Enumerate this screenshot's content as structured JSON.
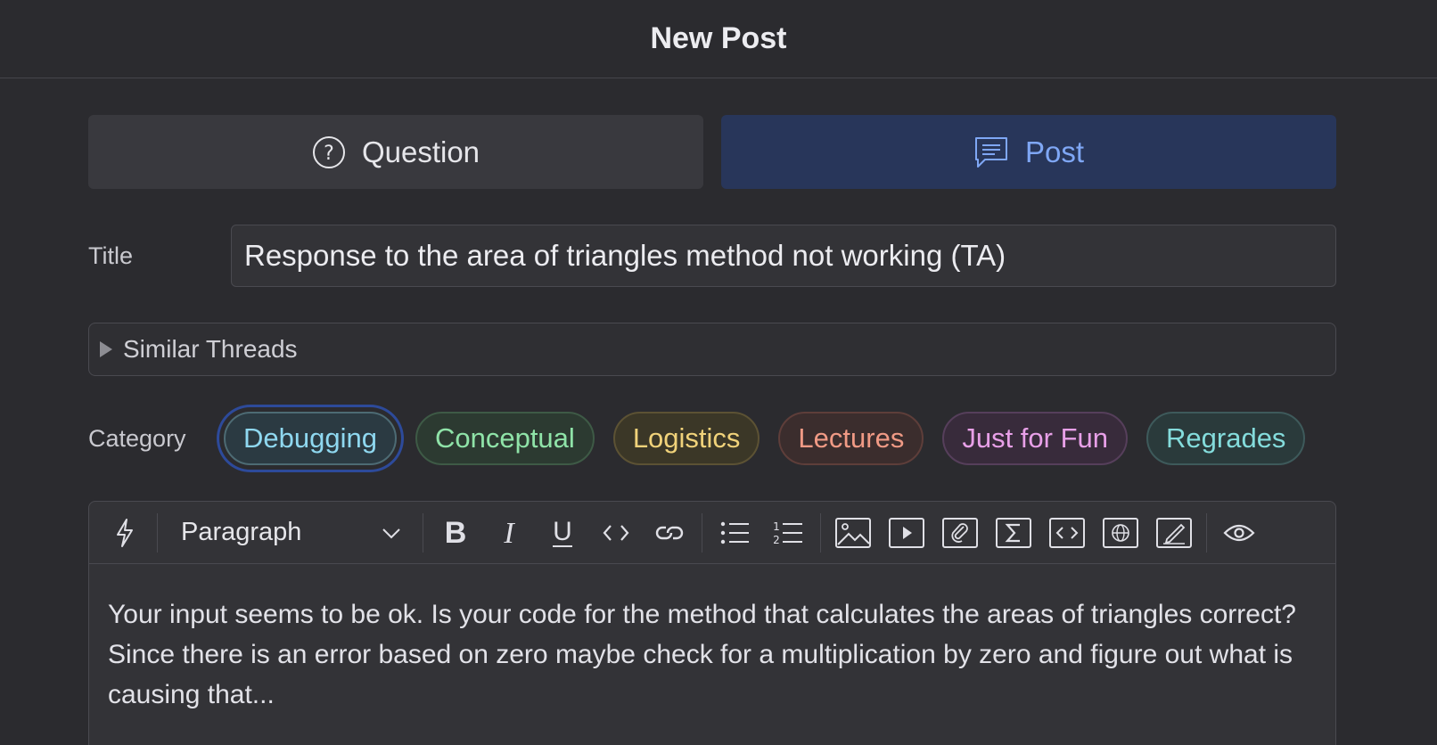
{
  "header": {
    "title": "New Post"
  },
  "type_selector": {
    "question_label": "Question",
    "post_label": "Post",
    "selected": "post"
  },
  "title_field": {
    "label": "Title",
    "value": "Response to the area of triangles method not working (TA)"
  },
  "similar_threads": {
    "label": "Similar Threads"
  },
  "category": {
    "label": "Category",
    "chips": [
      "Debugging",
      "Conceptual",
      "Logistics",
      "Lectures",
      "Just for Fun",
      "Regrades"
    ],
    "selected": "Debugging"
  },
  "editor": {
    "block_format": "Paragraph",
    "toolbar_icons": [
      "lightning-icon",
      "bold-icon",
      "italic-icon",
      "underline-icon",
      "inline-code-icon",
      "link-icon",
      "bullet-list-icon",
      "numbered-list-icon",
      "image-icon",
      "video-icon",
      "attachment-icon",
      "math-icon",
      "code-block-icon",
      "web-embed-icon",
      "draw-icon",
      "preview-icon"
    ],
    "body": "Your input seems to be ok. Is your code for the method that calculates the areas of triangles correct? Since there is an error based on zero maybe check for a multiplication by zero and figure out what is causing that..."
  },
  "colors": {
    "background": "#2b2b2f",
    "post_active_bg": "#28365a",
    "post_active_text": "#7fa7f5",
    "selected_chip_ring": "#2d4a9a"
  }
}
